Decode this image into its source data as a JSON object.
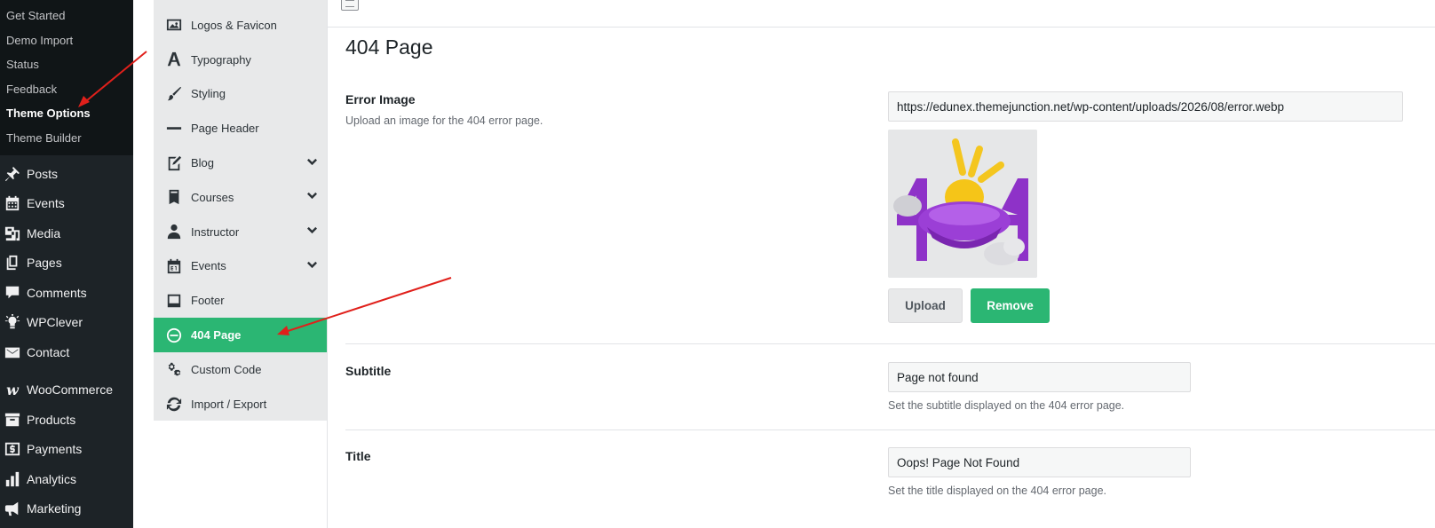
{
  "wp_submenu": [
    {
      "label": "Get Started"
    },
    {
      "label": "Demo Import"
    },
    {
      "label": "Status"
    },
    {
      "label": "Feedback"
    },
    {
      "label": "Theme Options"
    },
    {
      "label": "Theme Builder"
    }
  ],
  "wp_menu": [
    {
      "label": "Posts",
      "icon": "pin-icon"
    },
    {
      "label": "Events",
      "icon": "calendar-icon"
    },
    {
      "label": "Media",
      "icon": "media-icon"
    },
    {
      "label": "Pages",
      "icon": "pages-icon"
    },
    {
      "label": "Comments",
      "icon": "comment-icon"
    },
    {
      "label": "WPClever",
      "icon": "lightbulb-icon"
    },
    {
      "label": "Contact",
      "icon": "envelope-icon"
    },
    {
      "label": "WooCommerce",
      "icon": "woocommerce-icon"
    },
    {
      "label": "Products",
      "icon": "archive-icon"
    },
    {
      "label": "Payments",
      "icon": "dollar-icon"
    },
    {
      "label": "Analytics",
      "icon": "bar-chart-icon"
    },
    {
      "label": "Marketing",
      "icon": "megaphone-icon"
    }
  ],
  "options_nav": [
    {
      "label": "Logos & Favicon",
      "icon": "image-icon"
    },
    {
      "label": "Typography",
      "icon": "typography-icon"
    },
    {
      "label": "Styling",
      "icon": "brush-icon"
    },
    {
      "label": "Page Header",
      "icon": "minus-bar-icon"
    },
    {
      "label": "Blog",
      "icon": "edit-page-icon"
    },
    {
      "label": "Courses",
      "icon": "book-icon"
    },
    {
      "label": "Instructor",
      "icon": "user-icon"
    },
    {
      "label": "Events",
      "icon": "calendar-31-icon"
    },
    {
      "label": "Footer",
      "icon": "footer-icon"
    },
    {
      "label": "404 Page",
      "icon": "no-entry-icon"
    },
    {
      "label": "Custom Code",
      "icon": "gears-icon"
    },
    {
      "label": "Import / Export",
      "icon": "refresh-icon"
    }
  ],
  "main": {
    "page_title": "404 Page",
    "error_image": {
      "label": "Error Image",
      "description": "Upload an image for the 404 error page.",
      "url_value": "https://edunex.themejunction.net/wp-content/uploads/2026/08/error.webp",
      "upload_label": "Upload",
      "remove_label": "Remove",
      "preview_text": "4"
    },
    "subtitle": {
      "label": "Subtitle",
      "value": "Page not found",
      "help": "Set the subtitle displayed on the 404 error page."
    },
    "title": {
      "label": "Title",
      "value": "Oops! Page Not Found",
      "help": "Set the title displayed on the 404 error page."
    }
  },
  "colors": {
    "wp_sidebar_bg": "#1d2327",
    "active_green": "#2bb673",
    "annotation_red": "#e0201b"
  }
}
